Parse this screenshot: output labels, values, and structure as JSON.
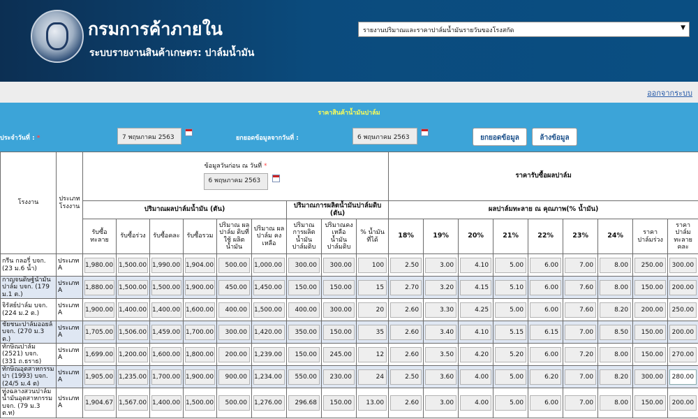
{
  "header": {
    "title": "กรมการค้าภายใน",
    "subtitle": "ระบบรายงานสินค้าเกษตร: ปาล์มน้ำมัน",
    "report_select": "รายงานปริมาณและราคาปาล์มน้ำมันรายวันของโรงสกัด"
  },
  "logout": "ออกจากระบบ",
  "section": {
    "title": "ราคาสินค้าน้ำมันปาล์ม",
    "date_label": "ประจำวันที่ :",
    "date_value": "7 พฤษภาคม 2563",
    "carry_label": "ยกยอดข้อมูลจากวันที่ :",
    "carry_value": "6 พฤษภาคม 2563",
    "carry_button": "ยกยอดข้อมูล",
    "clear_button": "ล้างข้อมูล"
  },
  "table": {
    "h_factory": "โรงงาน",
    "h_type": "ประเภท โรงงาน",
    "prev_label": "ข้อมูลวันก่อน ณ วันที่",
    "prev_date": "6 พฤษภาคม 2563",
    "price_group": "ราคารับซื้อผลปาล์ม",
    "group_fruit": "ปริมาณผลปาล์มน้ำมัน (ตัน)",
    "group_crude": "ปริมาณการผลิตน้ำมันปาล์มดิบ (ตัน)",
    "group_quality": "ผลปาล์มทะลาย ณ คุณภาพ(% น้ำมัน)",
    "cols": [
      "รับซื้อ ทะลาย",
      "รับซื้อร่วง",
      "รับซื้อคละ",
      "รับซื้อรวม",
      "ปริมาณ ผลปาล์ม ดิบที่ใช้ ผลิตน้ำมัน",
      "ปริมาณ ผลปาล์ม คงเหลือ",
      "ปริมาณ การผลิต น้ำมัน ปาล์มดิบ",
      "ปริมาณคง เหลือ น้ำมัน ปาล์มดิบ",
      "% น้ำมัน ที่ได้",
      "18%",
      "19%",
      "20%",
      "21%",
      "22%",
      "23%",
      "24%",
      "ราคา ปาล์มร่วง",
      "ราคาปาล์ม ทะลาย คละ"
    ],
    "rows": [
      {
        "factory": "กรีน กลอรี่ บจก. (23 ม.6 น้ำ)",
        "type": "ประเภท A",
        "values": [
          "1,980.00",
          "1,500.00",
          "1,990.00",
          "1,904.00",
          "500.00",
          "1,000.00",
          "300.00",
          "300.00",
          "100",
          "2.50",
          "3.00",
          "4.10",
          "5.00",
          "6.00",
          "7.00",
          "8.00",
          "250.00",
          "300.00"
        ]
      },
      {
        "factory": "กาญจนดิษฐ์น้ำมัน ปาล์ม บจก. (179 ม.1 ต.)",
        "type": "ประเภท A",
        "values": [
          "1,880.00",
          "1,500.00",
          "1,500.00",
          "1,900.00",
          "450.00",
          "1,450.00",
          "150.00",
          "150.00",
          "15",
          "2.70",
          "3.20",
          "4.15",
          "5.10",
          "6.00",
          "7.60",
          "8.00",
          "150.00",
          "200.00"
        ]
      },
      {
        "factory": "จิรัสย์ปาล์ม บจก. (224 ม.2 ต.)",
        "type": "ประเภท A",
        "values": [
          "1,900.00",
          "1,400.00",
          "1,400.00",
          "1,600.00",
          "400.00",
          "1,500.00",
          "400.00",
          "300.00",
          "20",
          "2.60",
          "3.30",
          "4.25",
          "5.00",
          "6.00",
          "7.60",
          "8.20",
          "200.00",
          "250.00"
        ]
      },
      {
        "factory": "ชัยชนะปาล์มออยล์ บจก. (270 ม.3 ต.)",
        "type": "ประเภท A",
        "values": [
          "1,705.00",
          "1,506.00",
          "1,459.00",
          "1,700.00",
          "300.00",
          "1,420.00",
          "350.00",
          "150.00",
          "35",
          "2.60",
          "3.40",
          "4.10",
          "5.15",
          "6.15",
          "7.00",
          "8.50",
          "150.00",
          "200.00"
        ]
      },
      {
        "factory": "ทักษิณปาล์ม (2521) บจก. (331 ถ.ธราธ)",
        "type": "ประเภท A",
        "values": [
          "1,699.00",
          "1,200.00",
          "1,600.00",
          "1,800.00",
          "200.00",
          "1,239.00",
          "150.00",
          "245.00",
          "12",
          "2.60",
          "3.50",
          "4.20",
          "5.20",
          "6.00",
          "7.20",
          "8.00",
          "150.00",
          "270.00"
        ]
      },
      {
        "factory": "ทักษิณอุตสาหกรรมปา (1993) บจก. (24/5 ม.4 ต)",
        "type": "ประเภท A",
        "values": [
          "1,905.00",
          "1,235.00",
          "1,700.00",
          "1,900.00",
          "900.00",
          "1,234.00",
          "550.00",
          "230.00",
          "24",
          "2.50",
          "3.60",
          "4.00",
          "5.00",
          "6.20",
          "7.00",
          "8.20",
          "300.00",
          "280.00"
        ]
      },
      {
        "factory": "ทุ่งฉลางสวนปาล์ม น้ำมันอุตสาหกรรม บจก. (79 ม.3 ต.ท)",
        "type": "ประเภท A",
        "values": [
          "1,904.67",
          "1,567.00",
          "1,400.00",
          "1,500.00",
          "500.00",
          "1,276.00",
          "296.68",
          "150.00",
          "13.00",
          "2.60",
          "3.00",
          "4.00",
          "5.00",
          "6.00",
          "7.00",
          "8.00",
          "150.00",
          "200.00"
        ]
      }
    ]
  }
}
